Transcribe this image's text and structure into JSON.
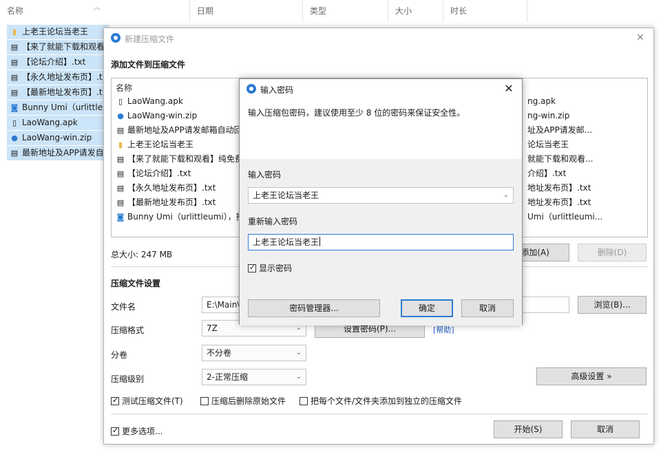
{
  "explorer": {
    "columns": {
      "name": "名称",
      "date": "日期",
      "type": "类型",
      "size": "大小",
      "duration": "时长"
    },
    "files": [
      {
        "icon": "folder-icon",
        "name": "上老王论坛当老王"
      },
      {
        "icon": "text-file-icon",
        "name": "【来了就能下载和观看"
      },
      {
        "icon": "text-file-icon",
        "name": "【论坛介绍】.txt"
      },
      {
        "icon": "text-file-icon",
        "name": "【永久地址发布页】.t"
      },
      {
        "icon": "text-file-icon",
        "name": "【最新地址发布页】.t"
      },
      {
        "icon": "link-file-icon",
        "name": "Bunny Umi（urlittleu"
      },
      {
        "icon": "apk-file-icon",
        "name": "LaoWang.apk"
      },
      {
        "icon": "zip-file-icon",
        "name": "LaoWang-win.zip"
      },
      {
        "icon": "text-file-icon",
        "name": "最新地址及APP请发自"
      }
    ]
  },
  "main_dialog": {
    "title": "新建压缩文件",
    "add_section": "添加文件到压缩文件",
    "list_header": "名称",
    "list_items": [
      {
        "icon": "apk-file-icon",
        "name": "LaoWang.apk"
      },
      {
        "icon": "zip-file-icon",
        "name": "LaoWang-win.zip"
      },
      {
        "icon": "text-file-icon",
        "name": "最新地址及APP请发邮箱自动回"
      },
      {
        "icon": "folder-icon",
        "name": "上老王论坛当老王"
      },
      {
        "icon": "text-file-icon",
        "name": "【来了就能下载和观看】纯免费"
      },
      {
        "icon": "text-file-icon",
        "name": "【论坛介绍】.txt"
      },
      {
        "icon": "text-file-icon",
        "name": "【永久地址发布页】.txt"
      },
      {
        "icon": "text-file-icon",
        "name": "【最新地址发布页】.txt"
      },
      {
        "icon": "link-file-icon",
        "name": "Bunny Umi（urlittleumi），推"
      }
    ],
    "right_items": [
      "ng.apk",
      "ng-win.zip",
      "址及APP请发邮...",
      "论坛当老王",
      "就能下载和观看...",
      "介绍】.txt",
      "地址发布页】.txt",
      "地址发布页】.txt",
      "Umi（urlittleumi..."
    ],
    "total_size": "总大小: 247 MB",
    "add_button": "添加(A)",
    "delete_button": "删除(D)",
    "settings_section": "压缩文件设置",
    "filename_label": "文件名",
    "filename_value": "E:\\Main\\",
    "browse_button": "浏览(B)...",
    "format_label": "压缩格式",
    "format_value": "7Z",
    "set_password_button": "设置密码(P)...",
    "help_link": "[帮助]",
    "split_label": "分卷",
    "split_value": "不分卷",
    "level_label": "压缩级别",
    "level_value": "2-正常压缩",
    "advanced_button": "高级设置 »",
    "test_checkbox": "测试压缩文件(T)",
    "test_checked": true,
    "delete_checkbox": "压缩后删除原始文件",
    "delete_checked": false,
    "separate_checkbox": "把每个文件/文件夹添加到独立的压缩文件",
    "separate_checked": false,
    "more_checkbox": "更多选项...",
    "more_checked": true,
    "start_button": "开始(S)",
    "cancel_button": "取消"
  },
  "password_dialog": {
    "title": "输入密码",
    "description": "输入压缩包密码，建议使用至少 8 位的密码来保证安全性。",
    "password_label": "输入密码",
    "password_value": "上老王论坛当老王",
    "confirm_label": "重新输入密码",
    "confirm_value": "上老王论坛当老王",
    "show_password": "显示密码",
    "show_password_checked": true,
    "manager_button": "密码管理器...",
    "ok_button": "确定",
    "cancel_button": "取消"
  },
  "colors": {
    "selection": "#cce4f7",
    "accent": "#2b7bd1",
    "dialog_bg": "#f0f0f0"
  }
}
